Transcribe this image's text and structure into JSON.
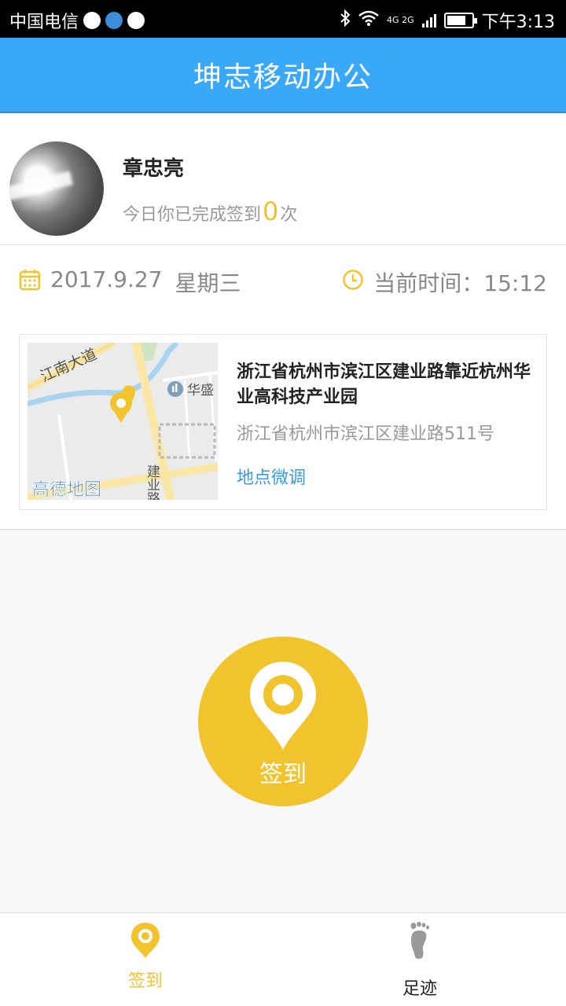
{
  "status_bar": {
    "carrier": "中国电信",
    "network": "4G 2G",
    "time": "下午3:13",
    "battery_level": 0.75
  },
  "header": {
    "title": "坤志移动办公"
  },
  "profile": {
    "name": "章忠亮",
    "signin_prefix": "今日你已完成签到",
    "signin_count": "0",
    "signin_suffix": "次"
  },
  "date_row": {
    "date": "2017.9.27",
    "weekday": "星期三",
    "time_label": "当前时间：",
    "current_time": "15:12"
  },
  "location": {
    "title": "浙江省杭州市滨江区建业路靠近杭州华业高科技产业园",
    "address": "浙江省杭州市滨江区建业路511号",
    "adjust_label": "地点微调",
    "map": {
      "road_1": "江南大道",
      "poi": "华盛",
      "road_2": "建业路",
      "logo": "高德地图"
    }
  },
  "signin_button": {
    "label": "签到"
  },
  "bottom_nav": {
    "items": [
      {
        "label": "签到",
        "icon": "location-pin-icon"
      },
      {
        "label": "足迹",
        "icon": "footprint-icon"
      }
    ]
  },
  "colors": {
    "header": "#3aa8f8",
    "accent_yellow": "#f1c42e",
    "link_blue": "#3a9be0"
  }
}
